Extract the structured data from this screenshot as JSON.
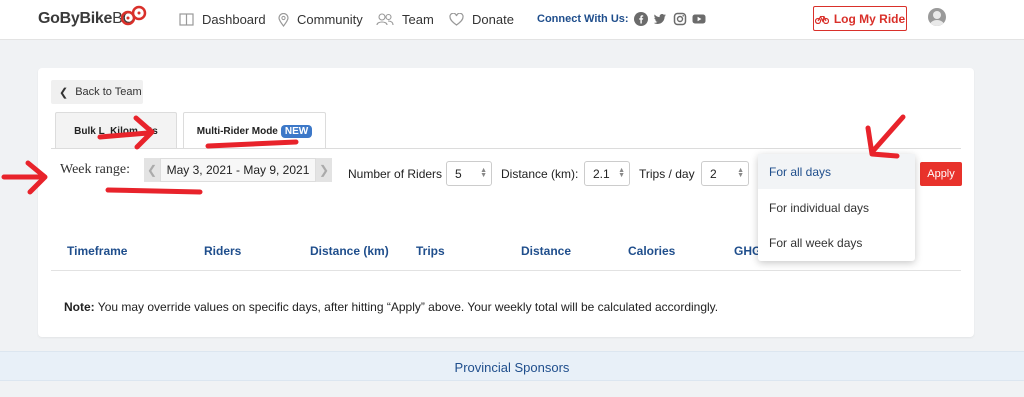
{
  "header": {
    "logo_main": "GoByBike",
    "logo_suffix": "BC",
    "nav": [
      {
        "label": "Dashboard",
        "icon": "book-icon"
      },
      {
        "label": "Community",
        "icon": "location-pin-icon"
      },
      {
        "label": "Team",
        "icon": "users-icon"
      },
      {
        "label": "Donate",
        "icon": "heart-icon"
      }
    ],
    "connect_label": "Connect With Us:",
    "social": [
      "facebook-icon",
      "twitter-icon",
      "instagram-icon",
      "youtube-icon"
    ],
    "log_ride_label": "Log My Ride",
    "brand_color": "#d9302a",
    "accent_color": "#1f4e8c"
  },
  "back_label": "Back to Team",
  "tabs": [
    {
      "label": "Bulk L  Kilom    ts",
      "active": false
    },
    {
      "label": "Multi-Rider Mode",
      "badge": "NEW",
      "active": true
    }
  ],
  "week_range": {
    "label": "Week range:",
    "value": "May 3, 2021 - May 9, 2021"
  },
  "fields": {
    "riders_label": "Number of Riders",
    "riders_value": "5",
    "distance_label": "Distance (km):",
    "distance_value": "2.1",
    "trips_label": "Trips / day",
    "trips_value": "2"
  },
  "apply_label": "Apply",
  "dropdown": {
    "options": [
      "For all days",
      "For individual days",
      "For all week days"
    ],
    "selected": "For all days"
  },
  "table": {
    "headers": [
      "Timeframe",
      "Riders",
      "Distance (km)",
      "Trips",
      "Distance",
      "Calories",
      "GHG"
    ]
  },
  "note": {
    "label": "Note:",
    "text": "You may override values on specific days, after hitting “Apply” above. Your weekly total will be calculated accordingly."
  },
  "footer": {
    "sponsors_label": "Provincial Sponsors"
  },
  "annotation_color": "#e8232b"
}
